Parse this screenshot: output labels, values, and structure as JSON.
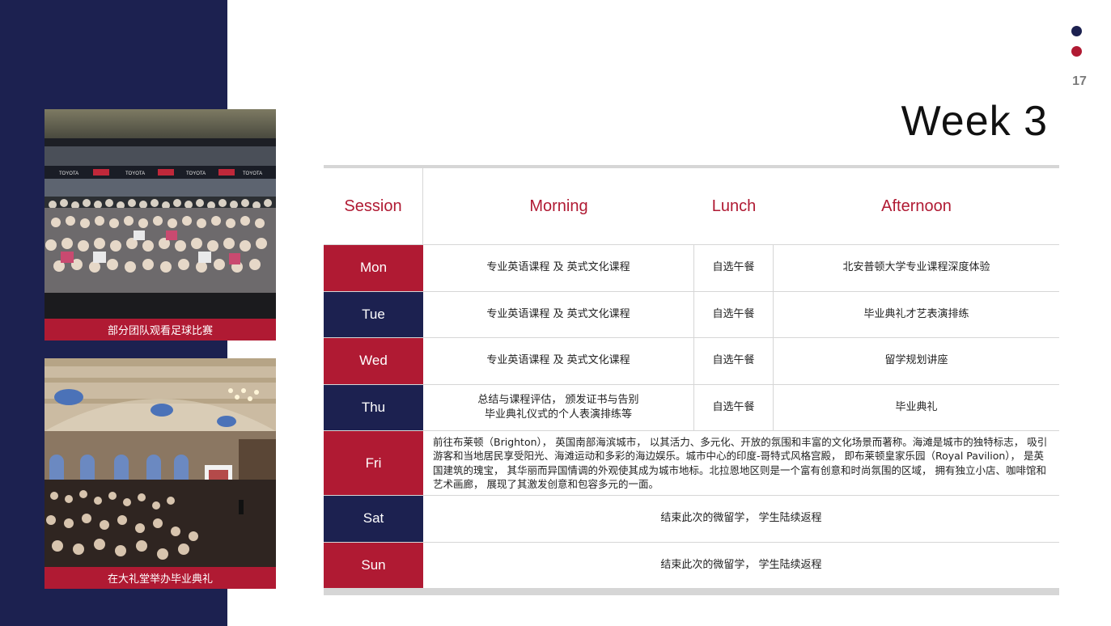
{
  "slide": {
    "page_number": "17",
    "title": "Week 3"
  },
  "photos": [
    {
      "caption": "部分团队观看足球比赛",
      "subject": "stadium-crowd"
    },
    {
      "caption": "在大礼堂举办毕业典礼",
      "subject": "great-hall-ceremony"
    }
  ],
  "colors": {
    "navy": "#1c2150",
    "red": "#b01a33",
    "rule": "#d6d6d6"
  },
  "table": {
    "headers": {
      "session": "Session",
      "morning": "Morning",
      "lunch": "Lunch",
      "afternoon": "Afternoon"
    },
    "rows": [
      {
        "day": "Mon",
        "morning": "专业英语课程  及  英式文化课程",
        "lunch": "自选午餐",
        "afternoon": "北安普顿大学专业课程深度体验"
      },
      {
        "day": "Tue",
        "morning": "专业英语课程  及  英式文化课程",
        "lunch": "自选午餐",
        "afternoon": "毕业典礼才艺表演排练"
      },
      {
        "day": "Wed",
        "morning": "专业英语课程  及  英式文化课程",
        "lunch": "自选午餐",
        "afternoon": "留学规划讲座"
      },
      {
        "day": "Thu",
        "morning_line1": "总结与课程评估，  颁发证书与告别",
        "morning_line2": "毕业典礼仪式的个人表演排练等",
        "lunch": "自选午餐",
        "afternoon": "毕业典礼"
      },
      {
        "day": "Fri",
        "description": "前往布莱顿（Brighton），  英国南部海滨城市，  以其活力、多元化、开放的氛围和丰富的文化场景而著称。海滩是城市的独特标志，  吸引游客和当地居民享受阳光、海滩运动和多彩的海边娱乐。城市中心的印度-哥特式风格宫殿，  即布莱顿皇家乐园（Royal Pavilion），  是英国建筑的瑰宝，  其华丽而异国情调的外观使其成为城市地标。北拉恩地区则是一个富有创意和时尚氛围的区域，  拥有独立小店、咖啡馆和艺术画廊，  展现了其激发创意和包容多元的一面。"
      },
      {
        "day": "Sat",
        "text": "结束此次的微留学，  学生陆续返程"
      },
      {
        "day": "Sun",
        "text": "结束此次的微留学，  学生陆续返程"
      }
    ]
  }
}
